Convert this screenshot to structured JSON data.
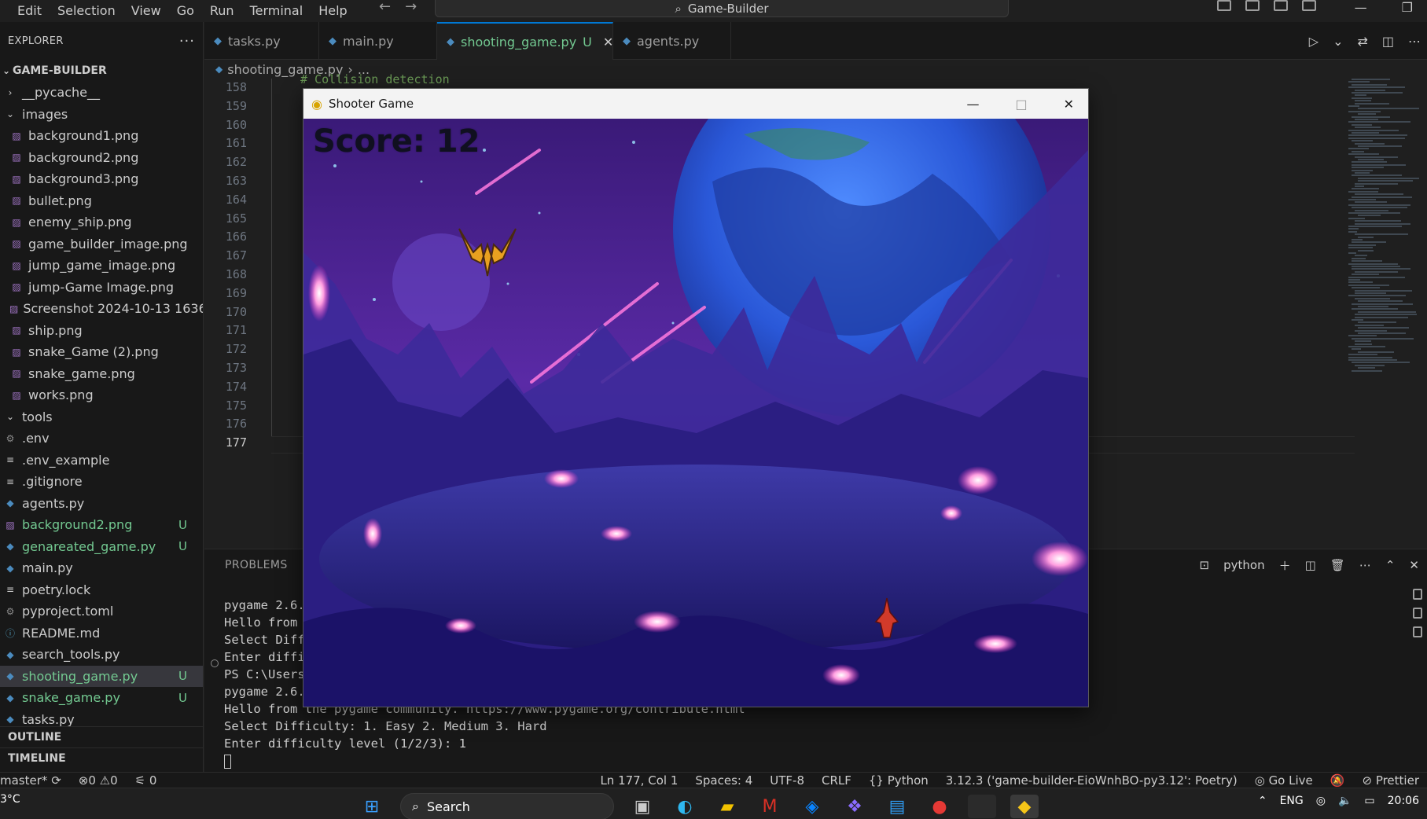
{
  "menu": [
    "Edit",
    "Selection",
    "View",
    "Go",
    "Run",
    "Terminal",
    "Help"
  ],
  "command_center": "Game-Builder",
  "sidebar": {
    "title": "EXPLORER",
    "root": "GAME-BUILDER",
    "items": [
      {
        "label": "__pycache__",
        "kind": "folder-closed",
        "icon": "chevron-right-icon"
      },
      {
        "label": "images",
        "kind": "folder-open",
        "icon": "chevron-down-icon"
      },
      {
        "label": "background1.png",
        "kind": "image",
        "indent": 1
      },
      {
        "label": "background2.png",
        "kind": "image",
        "indent": 1
      },
      {
        "label": "background3.png",
        "kind": "image",
        "indent": 1
      },
      {
        "label": "bullet.png",
        "kind": "image",
        "indent": 1
      },
      {
        "label": "enemy_ship.png",
        "kind": "image",
        "indent": 1
      },
      {
        "label": "game_builder_image.png",
        "kind": "image",
        "indent": 1
      },
      {
        "label": "jump_game_image.png",
        "kind": "image",
        "indent": 1
      },
      {
        "label": "jump-Game Image.png",
        "kind": "image",
        "indent": 1
      },
      {
        "label": "Screenshot 2024-10-13 1636...",
        "kind": "image",
        "indent": 1
      },
      {
        "label": "ship.png",
        "kind": "image",
        "indent": 1
      },
      {
        "label": "snake_Game (2).png",
        "kind": "image",
        "indent": 1
      },
      {
        "label": "snake_game.png",
        "kind": "image",
        "indent": 1
      },
      {
        "label": "works.png",
        "kind": "image",
        "indent": 1
      },
      {
        "label": "tools",
        "kind": "folder-open",
        "icon": "chevron-down-icon"
      },
      {
        "label": ".env",
        "kind": "gear"
      },
      {
        "label": ".env_example",
        "kind": "text"
      },
      {
        "label": ".gitignore",
        "kind": "text"
      },
      {
        "label": "agents.py",
        "kind": "python"
      },
      {
        "label": "background2.png",
        "kind": "image",
        "badge": "U"
      },
      {
        "label": "genareated_game.py",
        "kind": "python",
        "badge": "U"
      },
      {
        "label": "main.py",
        "kind": "python"
      },
      {
        "label": "poetry.lock",
        "kind": "text"
      },
      {
        "label": "pyproject.toml",
        "kind": "gear"
      },
      {
        "label": "README.md",
        "kind": "info"
      },
      {
        "label": "search_tools.py",
        "kind": "python"
      },
      {
        "label": "shooting_game.py",
        "kind": "python",
        "badge": "U",
        "selected": true
      },
      {
        "label": "snake_game.py",
        "kind": "python",
        "badge": "U"
      },
      {
        "label": "tasks.py",
        "kind": "python"
      }
    ],
    "outline": "OUTLINE",
    "timeline": "TIMELINE"
  },
  "tabs": [
    {
      "label": "tasks.py"
    },
    {
      "label": "main.py"
    },
    {
      "label": "shooting_game.py",
      "badge": "U",
      "active": true
    },
    {
      "label": "agents.py"
    }
  ],
  "breadcrumb": {
    "file": "shooting_game.py",
    "rest": "..."
  },
  "editor": {
    "line_numbers": [
      "158",
      "159",
      "160",
      "161",
      "162",
      "163",
      "164",
      "165",
      "166",
      "167",
      "168",
      "169",
      "170",
      "171",
      "172",
      "173",
      "174",
      "175",
      "176",
      "177"
    ],
    "current_line": "177",
    "partial_code": "# Collision detection"
  },
  "panel": {
    "tab": "PROBLEMS",
    "shell": "python",
    "terminal_lines": [
      "pygame 2.6.",
      "Hello from ",
      "Select Diff",
      "Enter diffi",
      "PS C:\\Users",
      "pygame 2.6.",
      "Hello from the pygame community. https://www.pygame.org/contribute.html",
      "Select Difficulty: 1. Easy 2. Medium 3. Hard",
      "Enter difficulty level (1/2/3): 1"
    ]
  },
  "statusbar": {
    "branch": "master*",
    "errors": "0",
    "warnings": "0",
    "ports": "0",
    "position": "Ln 177, Col 1",
    "spaces": "Spaces: 4",
    "encoding": "UTF-8",
    "eol": "CRLF",
    "language": "Python",
    "interpreter": "3.12.3 ('game-builder-EioWnhBO-py3.12': Poetry)",
    "go_live": "Go Live",
    "prettier": "Prettier"
  },
  "taskbar": {
    "weather": "3°C",
    "search": "Search",
    "language": "ENG",
    "time": "20:06"
  },
  "game": {
    "title": "Shooter Game",
    "score_text": "Score: 12",
    "score": 12
  }
}
